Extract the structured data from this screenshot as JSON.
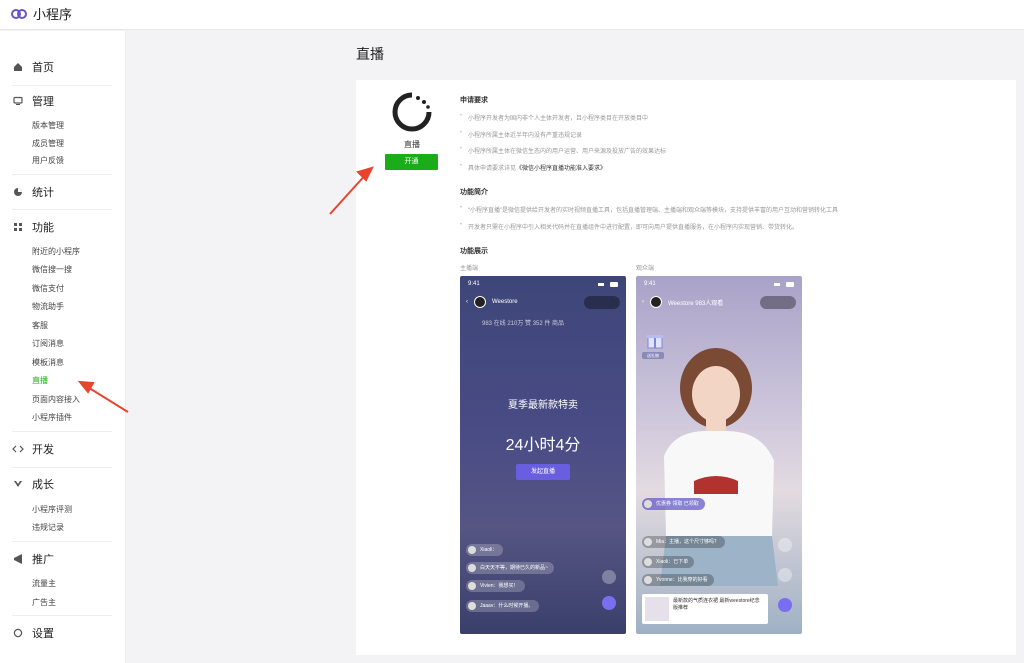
{
  "app": {
    "brand": "小程序"
  },
  "sidebar": {
    "home": "首页",
    "manage": {
      "label": "管理",
      "items": [
        "版本管理",
        "成员管理",
        "用户反馈"
      ]
    },
    "stats": "统计",
    "features": {
      "label": "功能",
      "items": [
        "附近的小程序",
        "微信搜一搜",
        "微信支付",
        "物流助手",
        "客服",
        "订阅消息",
        "模板消息",
        "直播",
        "页面内容接入",
        "小程序插件"
      ]
    },
    "dev": "开发",
    "growth": {
      "label": "成长",
      "items": [
        "小程序评测",
        "违规记录"
      ]
    },
    "promo": {
      "label": "推广",
      "items": [
        "流量主",
        "广告主"
      ]
    },
    "settings": "设置",
    "active_item": "直播"
  },
  "page": {
    "title": "直播",
    "feature_name": "直播",
    "open_button": "开通",
    "requirements": {
      "title": "申请要求",
      "items": [
        "小程序开发者为国内非个人主体开发者，且小程序类目在开放类目中",
        "小程序所属主体近半年内没有严重违规记录",
        "小程序所属主体在微信生态内的用户运营、用户来源及投放广告的效果达标",
        "具体申请要求详见"
      ],
      "link": "《微信小程序直播功能准入要求》"
    },
    "intro": {
      "title": "功能简介",
      "items": [
        "“小程序直播”是微信提供给开发者的实时视频直播工具，包括直播管理端、主播端和观众端等模块，支持提供丰富的用户互动和营销转化工具",
        "开发者只需在小程序中引入相关代码并在直播组件中进行配置，即可向用户提供直播服务，在小程序内实现营销、带货转化。"
      ]
    },
    "demo": {
      "title": "功能展示",
      "anchor_label": "主播端",
      "viewer_label": "观众端"
    }
  },
  "phone1": {
    "time": "9:41",
    "account": "Weestore",
    "stats": "983 在线  210万 赞  352 件 商品",
    "promo_line1": "夏季最新款特卖",
    "promo_line2": "24小时4分",
    "start_button": "发起直播",
    "comments": [
      "Xiaoli：",
      "白天天不等，期待已久的新品~",
      "Vivien：我想买！",
      "Jaaav：什么时候开播。"
    ]
  },
  "phone2": {
    "time": "9:41",
    "account": "Weestore",
    "viewers": "983人观看",
    "gift_label": "送礼物",
    "badge": "优惠券 领取 已领取",
    "comments": [
      "Mia：主播，这个尺寸够吗？",
      "Xiaoli：已下单",
      "Yvonne：比我穿的好看"
    ],
    "product_text": "最新款的气质连衣裙 最新weestore纪念版推荐"
  },
  "colors": {
    "accent": "#1aad19",
    "arrow": "#e8442e"
  }
}
